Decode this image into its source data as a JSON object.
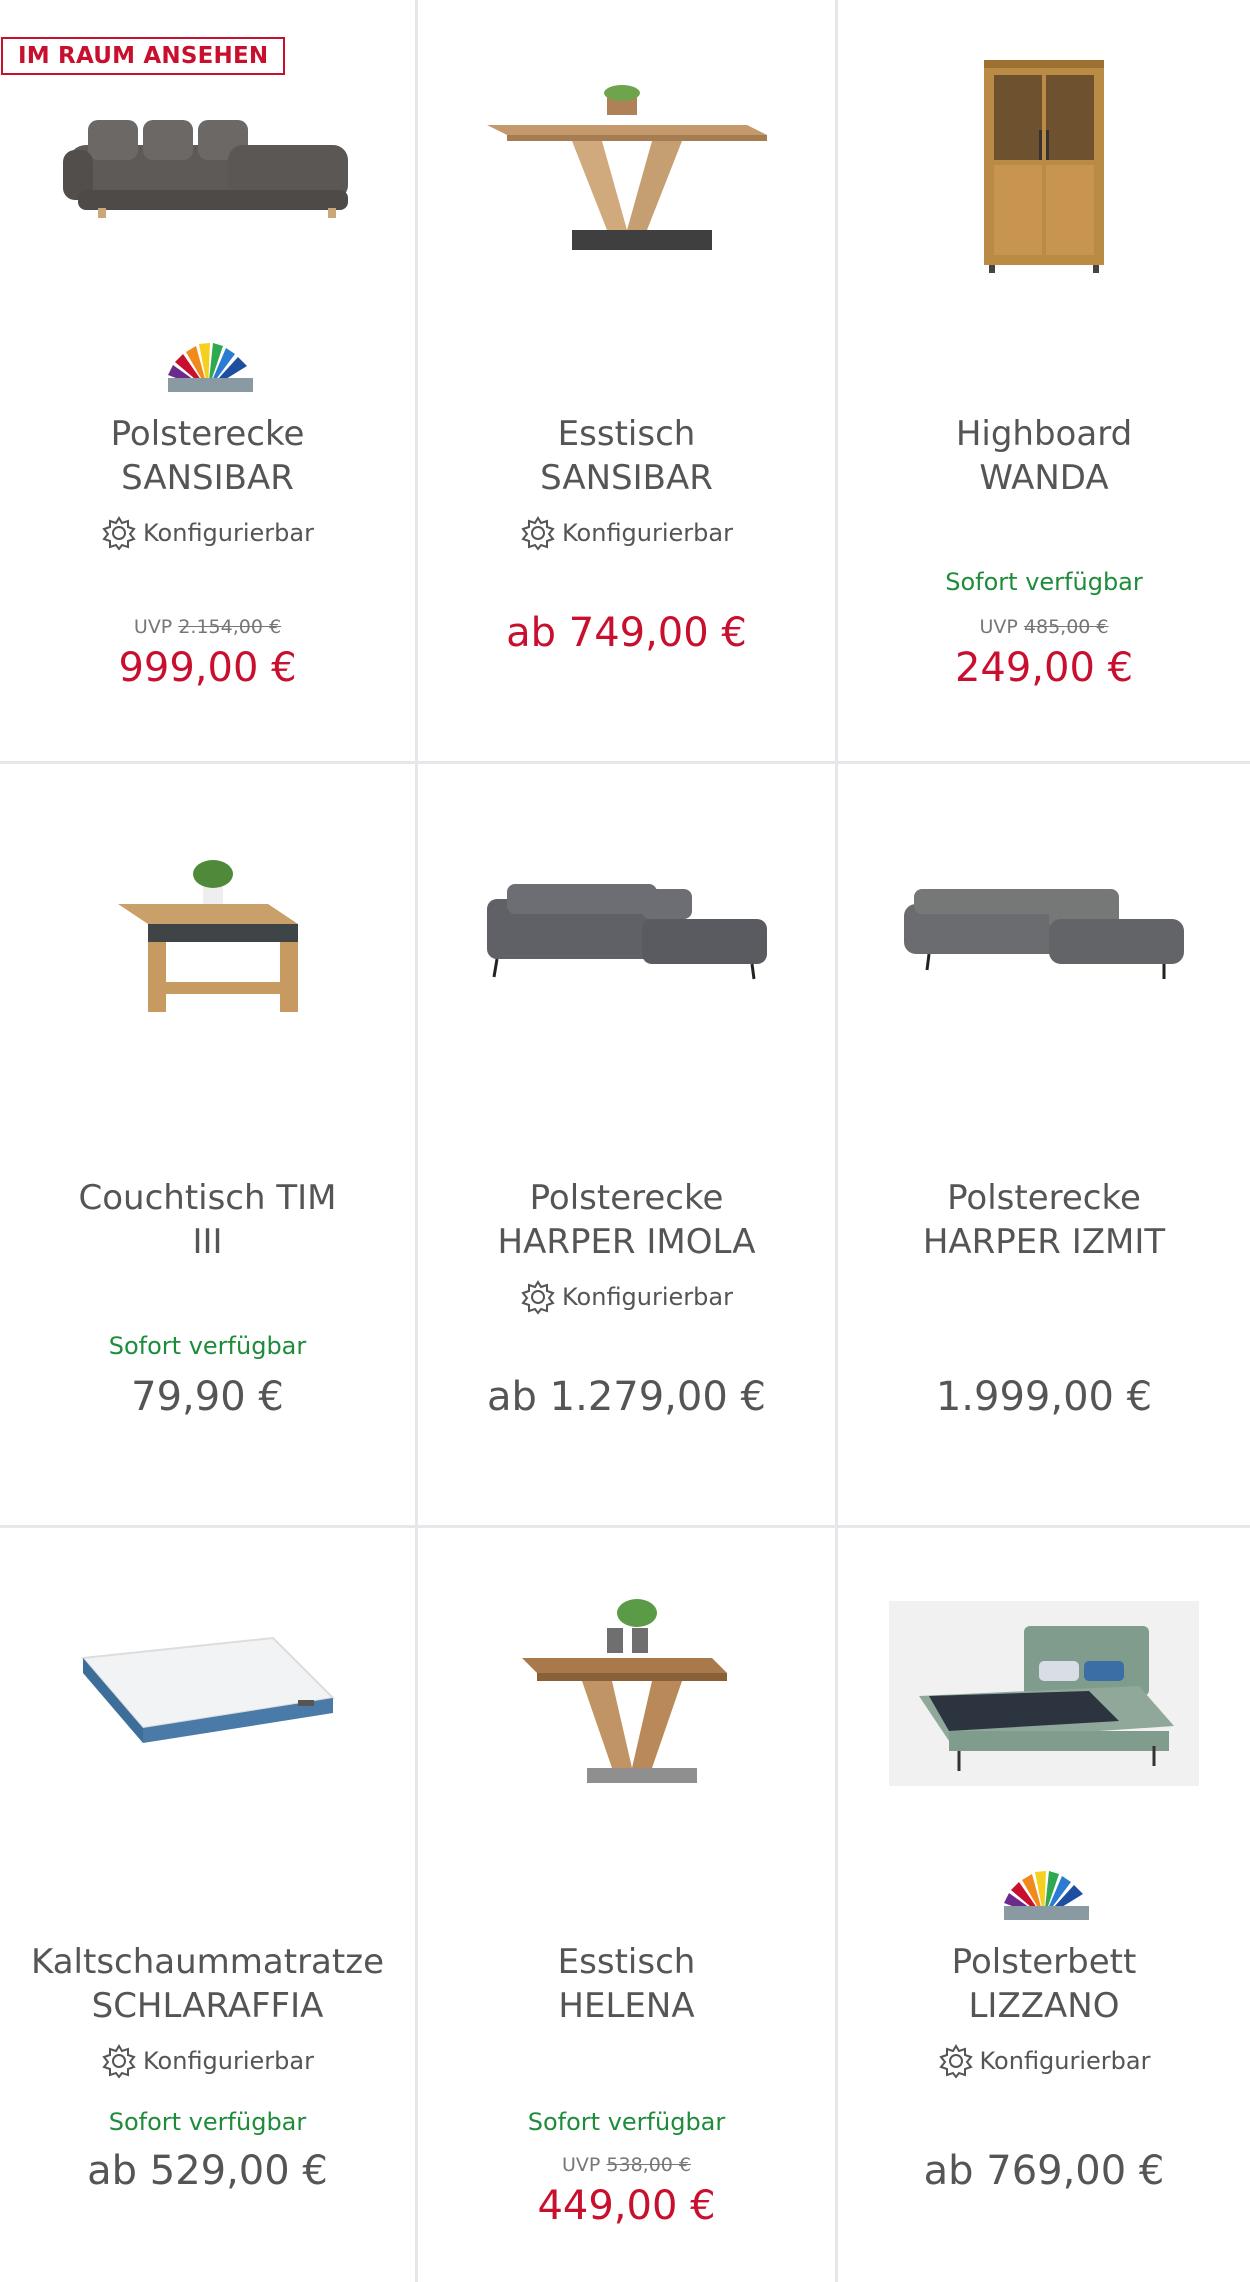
{
  "colors": {
    "sale_red": "#c8102e",
    "available_green": "#1e8c3a",
    "text_gray": "#555555",
    "divider": "#e5e7ea"
  },
  "products": [
    {
      "badge": "IM RAUM ANSEHEN",
      "image": "corner-sofa",
      "has_colorfan": true,
      "title_line1": "Polsterecke",
      "title_line2": "SANSIBAR",
      "config_label": "Konfigurierbar",
      "availability": "",
      "uvp_label": "UVP",
      "uvp_price": "2.154,00 €",
      "price": "999,00 €",
      "price_is_sale": true
    },
    {
      "badge": "",
      "image": "dining-table",
      "has_colorfan": false,
      "title_line1": "Esstisch",
      "title_line2": "SANSIBAR",
      "config_label": "Konfigurierbar",
      "availability": "",
      "uvp_label": "",
      "uvp_price": "",
      "price": "ab 749,00 €",
      "price_is_sale": true
    },
    {
      "badge": "",
      "image": "highboard",
      "has_colorfan": false,
      "title_line1": "Highboard",
      "title_line2": "WANDA",
      "config_label": "",
      "availability": "Sofort verfügbar",
      "uvp_label": "UVP",
      "uvp_price": "485,00 €",
      "price": "249,00 €",
      "price_is_sale": true
    },
    {
      "badge": "",
      "image": "coffee-table",
      "has_colorfan": false,
      "title_line1": "Couchtisch TIM",
      "title_line2": "III",
      "config_label": "",
      "availability": "Sofort verfügbar",
      "uvp_label": "",
      "uvp_price": "",
      "price": "79,90 €",
      "price_is_sale": false
    },
    {
      "badge": "",
      "image": "corner-sofa-gray",
      "has_colorfan": false,
      "title_line1": "Polsterecke",
      "title_line2": "HARPER IMOLA",
      "config_label": "Konfigurierbar",
      "availability": "",
      "uvp_label": "",
      "uvp_price": "",
      "price": "ab 1.279,00 €",
      "price_is_sale": false
    },
    {
      "badge": "",
      "image": "corner-sofa-gray-2",
      "has_colorfan": false,
      "title_line1": "Polsterecke",
      "title_line2": "HARPER IZMIT",
      "config_label": "",
      "availability": "",
      "uvp_label": "",
      "uvp_price": "",
      "price": "1.999,00 €",
      "price_is_sale": false
    },
    {
      "badge": "",
      "image": "mattress",
      "has_colorfan": false,
      "title_line1": "Kaltschaummatratze",
      "title_line2": "SCHLARAFFIA",
      "config_label": "Konfigurierbar",
      "availability": "Sofort verfügbar",
      "uvp_label": "",
      "uvp_price": "",
      "price": "ab 529,00 €",
      "price_is_sale": false
    },
    {
      "badge": "",
      "image": "dining-table-2",
      "has_colorfan": false,
      "title_line1": "Esstisch",
      "title_line2": "HELENA",
      "config_label": "",
      "availability": "Sofort verfügbar",
      "uvp_label": "UVP",
      "uvp_price": "538,00 €",
      "price": "449,00 €",
      "price_is_sale": true
    },
    {
      "badge": "",
      "image": "upholstered-bed",
      "has_colorfan": true,
      "title_line1": "Polsterbett",
      "title_line2": "LIZZANO",
      "config_label": "Konfigurierbar",
      "availability": "",
      "uvp_label": "",
      "uvp_price": "",
      "price": "ab 769,00 €",
      "price_is_sale": false
    }
  ]
}
